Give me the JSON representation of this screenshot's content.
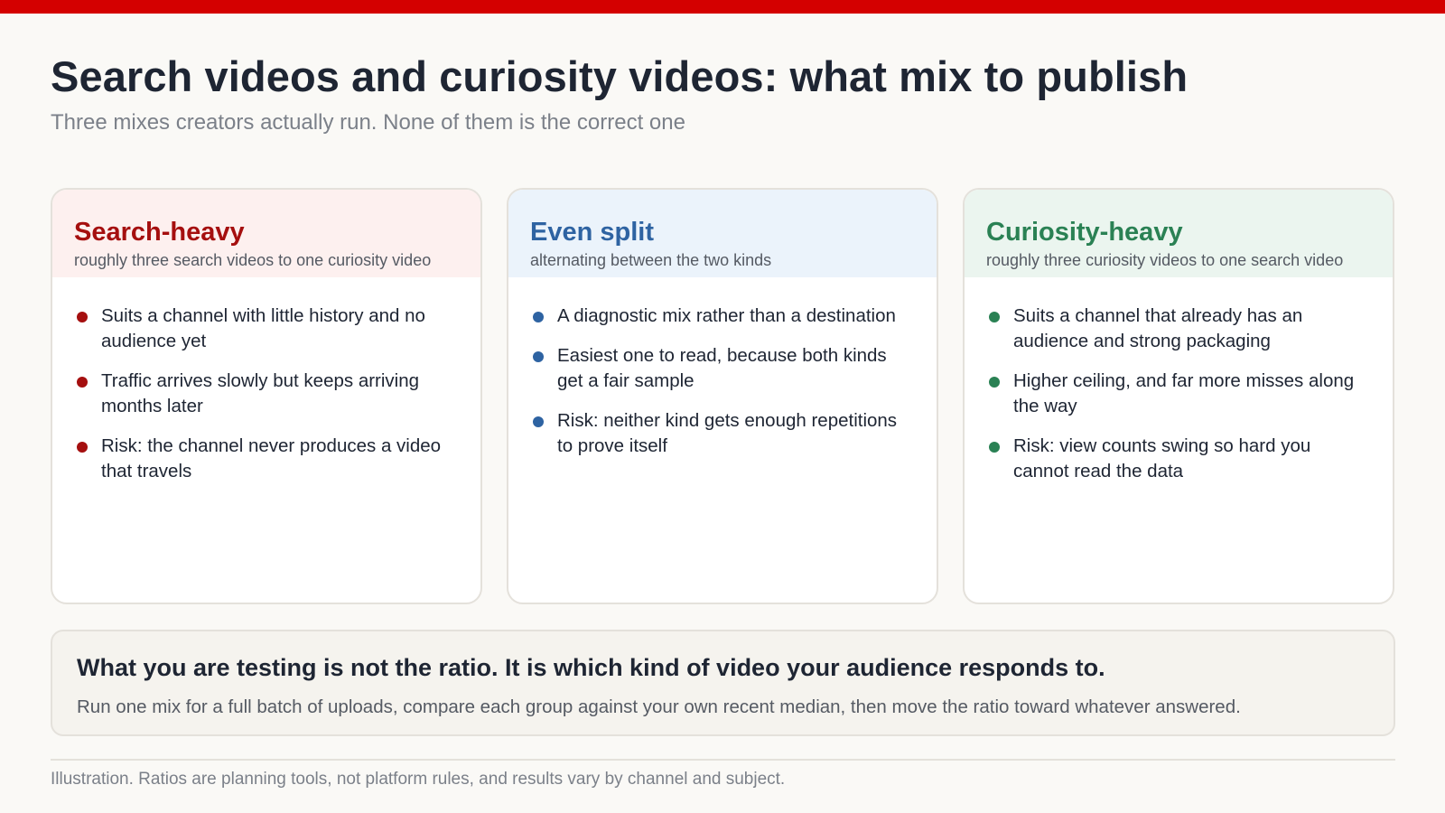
{
  "colors": {
    "accent_bar": "#d40000",
    "search_heavy": "#a50f0f",
    "even_split": "#2e63a2",
    "curiosity_heavy": "#2a8154"
  },
  "header": {
    "title": "Search videos and curiosity videos: what mix to publish",
    "subtitle": "Three mixes creators actually run. None of them is the correct one"
  },
  "cards": [
    {
      "title": "Search-heavy",
      "subtitle": "roughly three search videos to one curiosity video",
      "bullets": [
        "Suits a channel with little history and no audience yet",
        "Traffic arrives slowly but keeps arriving months later",
        "Risk: the channel never produces a video that travels"
      ]
    },
    {
      "title": "Even split",
      "subtitle": "alternating between the two kinds",
      "bullets": [
        "A diagnostic mix rather than a destination",
        "Easiest one to read, because both kinds get a fair sample",
        "Risk: neither kind gets enough repetitions to prove itself"
      ]
    },
    {
      "title": "Curiosity-heavy",
      "subtitle": "roughly three curiosity videos to one search video",
      "bullets": [
        "Suits a channel that already has an audience and strong packaging",
        "Higher ceiling, and far more misses along the way",
        "Risk: view counts swing so hard you cannot read the data"
      ]
    }
  ],
  "callout": {
    "heading": "What you are testing is not the ratio. It is which kind of video your audience responds to.",
    "body": "Run one mix for a full batch of uploads, compare each group against your own recent median, then move the ratio toward whatever answered."
  },
  "footnote": "Illustration. Ratios are planning tools, not platform rules, and results vary by channel and subject."
}
